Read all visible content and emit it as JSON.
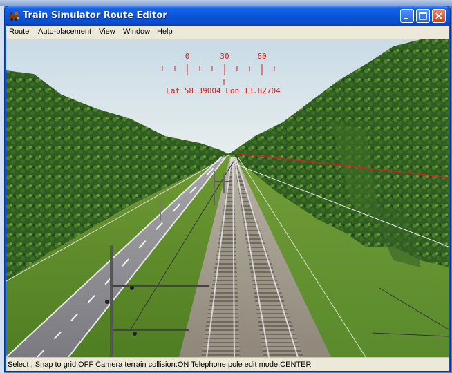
{
  "window": {
    "title": "Train Simulator Route Editor",
    "icon": "app-train-icon",
    "controls": [
      "minimize-icon",
      "maximize-icon",
      "close-icon"
    ]
  },
  "menu": {
    "items": [
      "Route",
      "Auto-placement",
      "View",
      "Window",
      "Help"
    ]
  },
  "compass": {
    "labels": [
      "0",
      "30",
      "60"
    ],
    "coordinates": "Lat 58.39004 Lon 13.82704",
    "color": "#d42020"
  },
  "status": {
    "text": "Select , Snap to grid:OFF Camera terrain collision:ON Telephone pole edit mode:CENTER"
  },
  "colors": {
    "titlebar": "#0a55d9",
    "menubar": "#ece9d8",
    "sky": "#dde8ee",
    "grass": "#5e8c2e",
    "trees": "#2c5a1e"
  }
}
